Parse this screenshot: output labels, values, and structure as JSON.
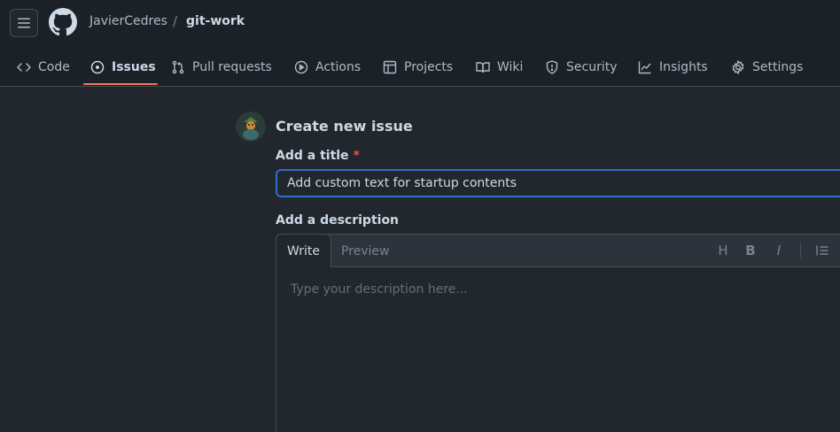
{
  "header": {
    "owner": "JavierCedres",
    "separator": "/",
    "repo": "git-work"
  },
  "tabs": [
    {
      "label": "Code",
      "icon": "code-icon"
    },
    {
      "label": "Issues",
      "icon": "issue-opened-icon",
      "active": true
    },
    {
      "label": "Pull requests",
      "icon": "git-pull-request-icon"
    },
    {
      "label": "Actions",
      "icon": "play-icon"
    },
    {
      "label": "Projects",
      "icon": "table-icon"
    },
    {
      "label": "Wiki",
      "icon": "book-icon"
    },
    {
      "label": "Security",
      "icon": "shield-icon"
    },
    {
      "label": "Insights",
      "icon": "graph-icon"
    },
    {
      "label": "Settings",
      "icon": "gear-icon"
    }
  ],
  "form": {
    "heading": "Create new issue",
    "title_label": "Add a title",
    "required_mark": "*",
    "title_value": "Add custom text for startup contents",
    "description_label": "Add a description",
    "description_placeholder": "Type your description here...",
    "editor_tabs": {
      "write": "Write",
      "preview": "Preview"
    },
    "toolbar": {
      "heading": "H",
      "bold": "B",
      "italic": "I"
    }
  },
  "colors": {
    "accent_underline": "#ec775c",
    "focus_border": "#316dca",
    "required": "#e5534b"
  }
}
